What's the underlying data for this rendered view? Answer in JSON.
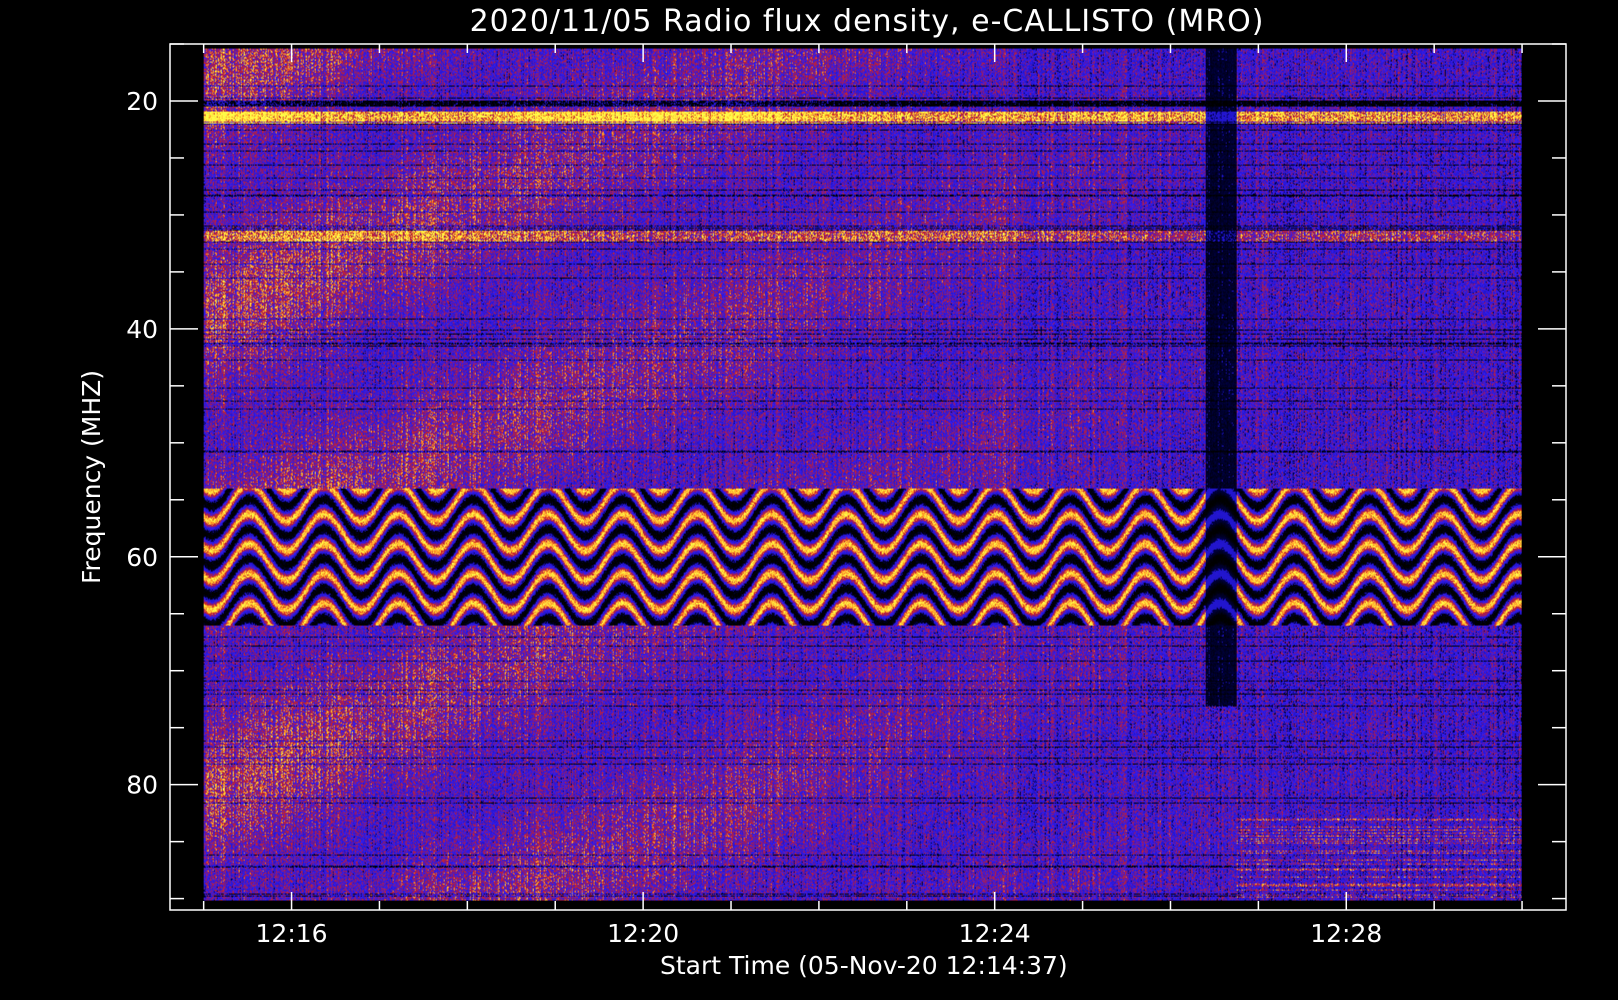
{
  "chart_data": {
    "type": "heatmap",
    "title": "2020/11/05  Radio flux density, e-CALLISTO (MRO)",
    "xlabel": "Start Time (05-Nov-20 12:14:37)",
    "ylabel": "Frequency (MHZ)",
    "x_ticks": [
      {
        "label": "12:16",
        "minutes": 16
      },
      {
        "label": "12:20",
        "minutes": 20
      },
      {
        "label": "12:24",
        "minutes": 24
      },
      {
        "label": "12:28",
        "minutes": 28
      }
    ],
    "x_range_minutes": [
      14.617,
      30.5
    ],
    "data_time_range_minutes": [
      15.0,
      30.0
    ],
    "y_ticks": [
      20,
      40,
      60,
      80
    ],
    "y_range_mhz": [
      15,
      91
    ],
    "y_reversed": true,
    "data_freq_range_mhz": [
      15.4,
      90.2
    ],
    "colormap": [
      "#000000",
      "#2222dd",
      "#3a2ad0",
      "#b81e1e",
      "#ffcf30"
    ],
    "features": [
      {
        "name": "rfi_band",
        "freq_mhz": 20.2,
        "intensity": "high"
      },
      {
        "name": "rfi_band",
        "freq_mhz": 21.4,
        "intensity": "high"
      },
      {
        "name": "rfi_band",
        "freq_mhz": 31.8,
        "intensity": "medium"
      },
      {
        "name": "wavy_band",
        "freq_mhz_range": [
          55,
          65
        ],
        "intensity": "high"
      },
      {
        "name": "dark_gap",
        "time_minutes": 26.4,
        "duration_minutes": 0.35
      }
    ]
  }
}
